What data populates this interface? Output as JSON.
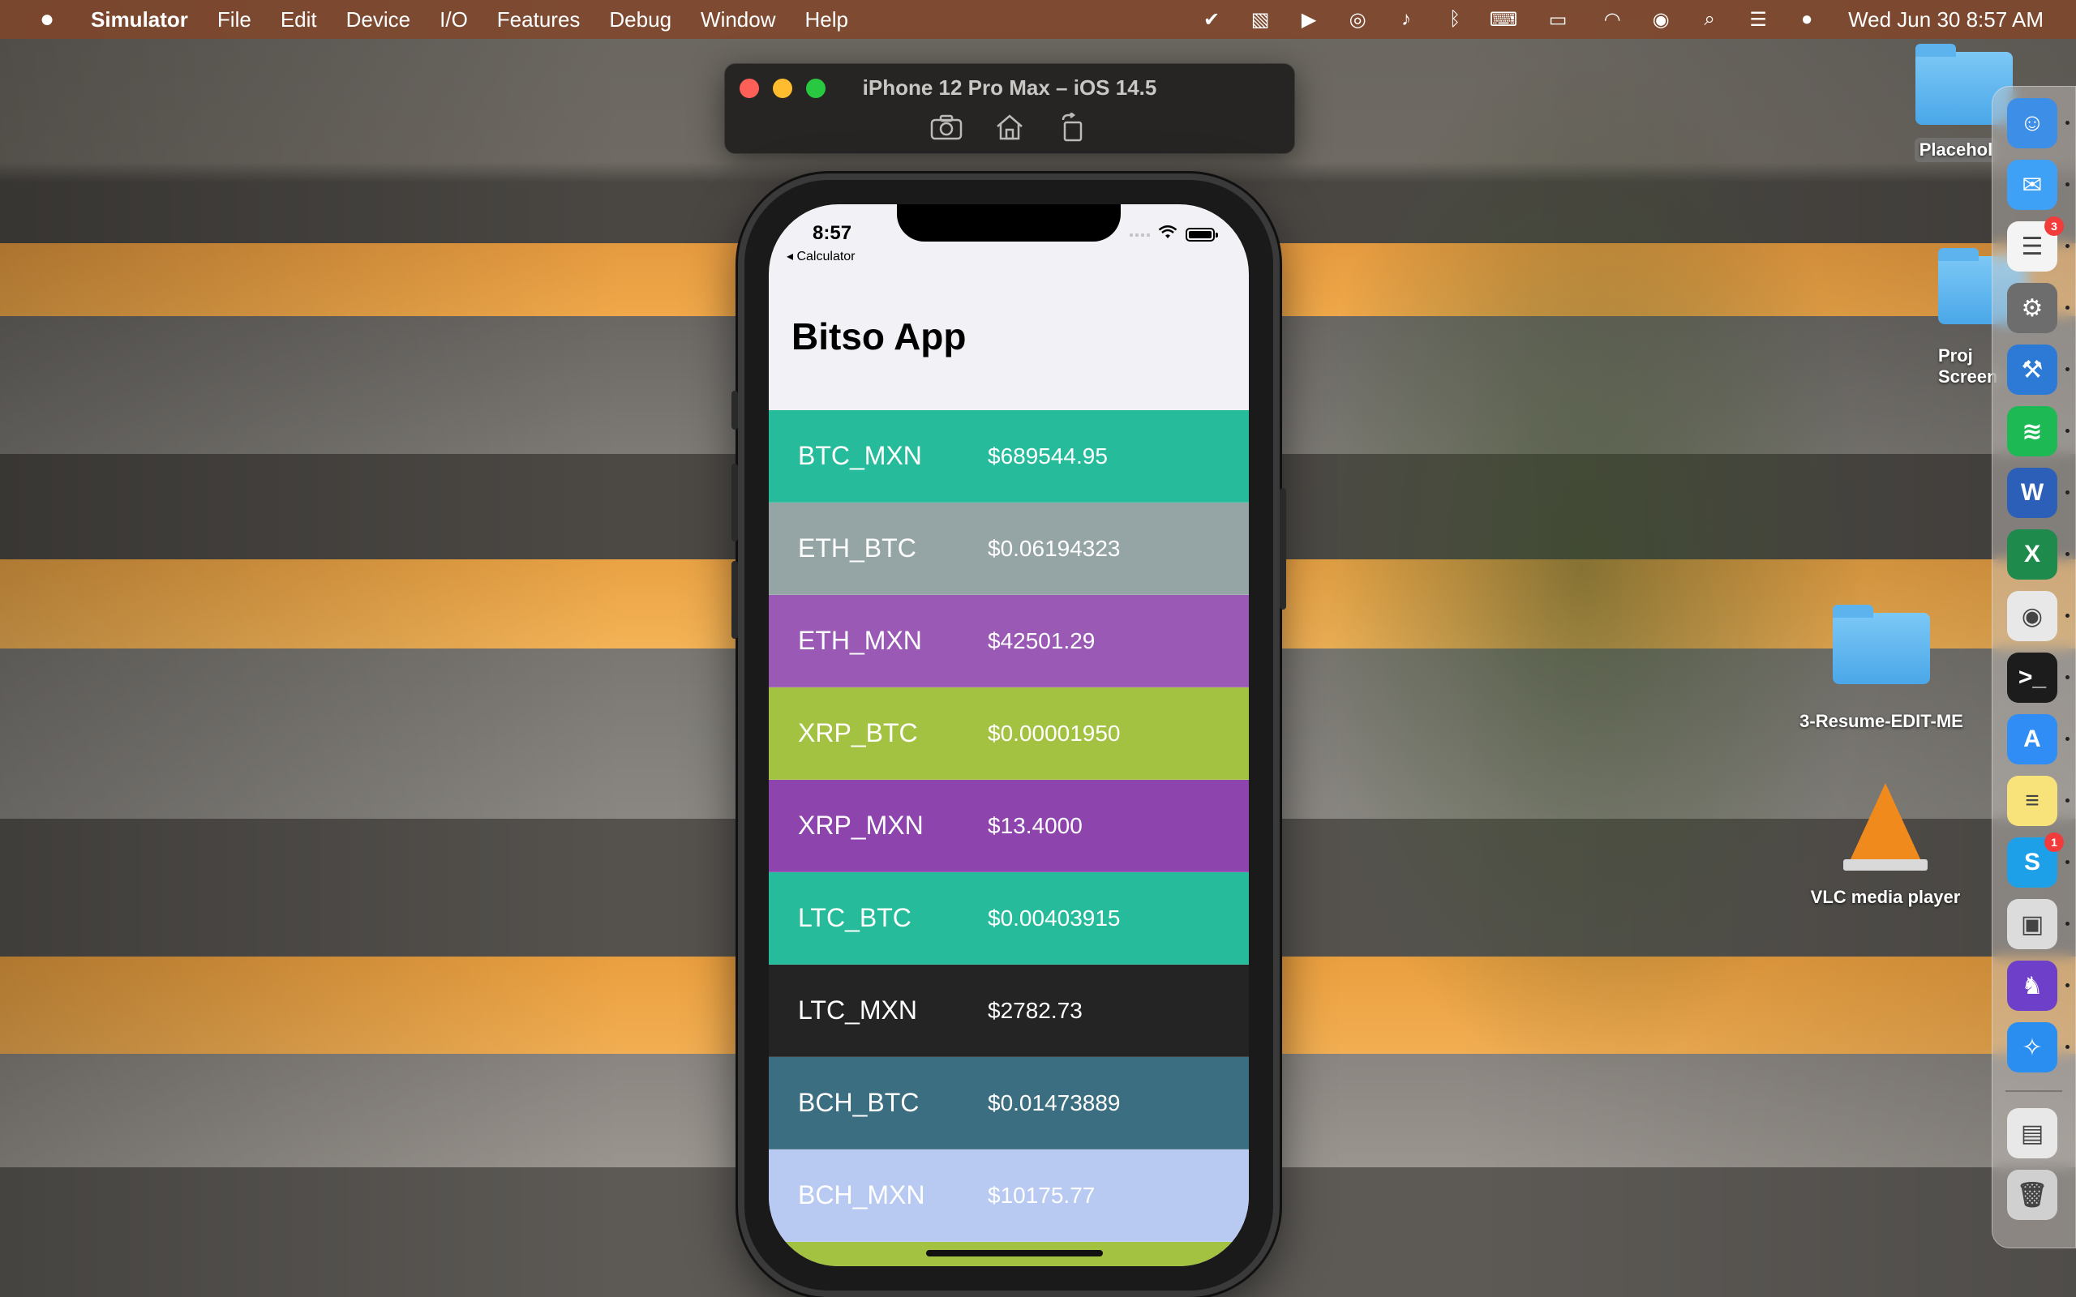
{
  "menubar": {
    "apple": "",
    "app_name": "Simulator",
    "items": [
      "File",
      "Edit",
      "Device",
      "I/O",
      "Features",
      "Debug",
      "Window",
      "Help"
    ],
    "clock": "Wed Jun 30  8:57 AM",
    "status_icons": [
      "checkmark-shield-icon",
      "clipboard-icon",
      "play-icon",
      "airdrop-icon",
      "mute-icon",
      "bluetooth-icon",
      "keyboard-icon",
      "battery-icon",
      "wifi-icon",
      "user-icon",
      "search-icon",
      "control-center-icon",
      "siri-icon"
    ]
  },
  "simulator": {
    "title": "iPhone 12 Pro Max – iOS 14.5",
    "tools": [
      "screenshot-icon",
      "home-icon",
      "rotate-icon"
    ]
  },
  "phone": {
    "time": "8:57",
    "back_label": "◂ Calculator",
    "nav_title": "Bitso App",
    "tickers": [
      {
        "name": "BTC_MXN",
        "price": "$689544.95",
        "color": "#26bc9b"
      },
      {
        "name": "ETH_BTC",
        "price": "$0.06194323",
        "color": "#95a5a6"
      },
      {
        "name": "ETH_MXN",
        "price": "$42501.29",
        "color": "#9b59b6"
      },
      {
        "name": "XRP_BTC",
        "price": "$0.00001950",
        "color": "#a4c241"
      },
      {
        "name": "XRP_MXN",
        "price": "$13.4000",
        "color": "#8e44ad"
      },
      {
        "name": "LTC_BTC",
        "price": "$0.00403915",
        "color": "#26bc9b"
      },
      {
        "name": "LTC_MXN",
        "price": "$2782.73",
        "color": "#242424"
      },
      {
        "name": "BCH_BTC",
        "price": "$0.01473889",
        "color": "#3b6e80"
      },
      {
        "name": "BCH_MXN",
        "price": "$10175.77",
        "color": "#b8caf2"
      },
      {
        "name": "",
        "price": "",
        "color": "#a4c241"
      }
    ]
  },
  "desktop": {
    "icons": [
      {
        "label": "Placehol",
        "type": "folder"
      },
      {
        "label": "Proj\nScreen",
        "type": "folder"
      },
      {
        "label": "3-Resume-EDIT-ME",
        "type": "folder"
      },
      {
        "label": "VLC media player",
        "type": "vlc"
      }
    ]
  },
  "dock": {
    "apps": [
      {
        "name": "finder-icon",
        "glyph": "☺",
        "color": "#3d8ee6",
        "badge": ""
      },
      {
        "name": "mail-icon",
        "glyph": "✉",
        "color": "#3fa1f5",
        "badge": ""
      },
      {
        "name": "reminders-icon",
        "glyph": "☰",
        "color": "#f4f4f4",
        "badge": "3"
      },
      {
        "name": "system-preferences-icon",
        "glyph": "⚙",
        "color": "#6d6d6d",
        "badge": ""
      },
      {
        "name": "xcode-icon",
        "glyph": "⚒",
        "color": "#2d7ad6",
        "badge": ""
      },
      {
        "name": "spotify-icon",
        "glyph": "≋",
        "color": "#1db954",
        "badge": ""
      },
      {
        "name": "word-icon",
        "glyph": "W",
        "color": "#2b5fb8",
        "badge": ""
      },
      {
        "name": "excel-icon",
        "glyph": "X",
        "color": "#1e8a4c",
        "badge": ""
      },
      {
        "name": "chrome-icon",
        "glyph": "◉",
        "color": "#e8e8e8",
        "badge": ""
      },
      {
        "name": "terminal-icon",
        "glyph": ">_",
        "color": "#1c1c1c",
        "badge": ""
      },
      {
        "name": "app-store-icon",
        "glyph": "A",
        "color": "#2f8df5",
        "badge": ""
      },
      {
        "name": "notes-icon",
        "glyph": "≡",
        "color": "#f7e37a",
        "badge": ""
      },
      {
        "name": "skype-icon",
        "glyph": "S",
        "color": "#1ea0e8",
        "badge": "1"
      },
      {
        "name": "preview-icon",
        "glyph": "▣",
        "color": "#dcdcdc",
        "badge": ""
      },
      {
        "name": "github-icon",
        "glyph": "♞",
        "color": "#6e40c9",
        "badge": ""
      },
      {
        "name": "safari-icon",
        "glyph": "✧",
        "color": "#2a8ef0",
        "badge": ""
      },
      {
        "name": "downloads-icon",
        "glyph": "▤",
        "color": "#e8e8e8",
        "badge": ""
      },
      {
        "name": "trash-icon",
        "glyph": "🗑",
        "color": "#d0d0d0",
        "badge": ""
      }
    ]
  }
}
